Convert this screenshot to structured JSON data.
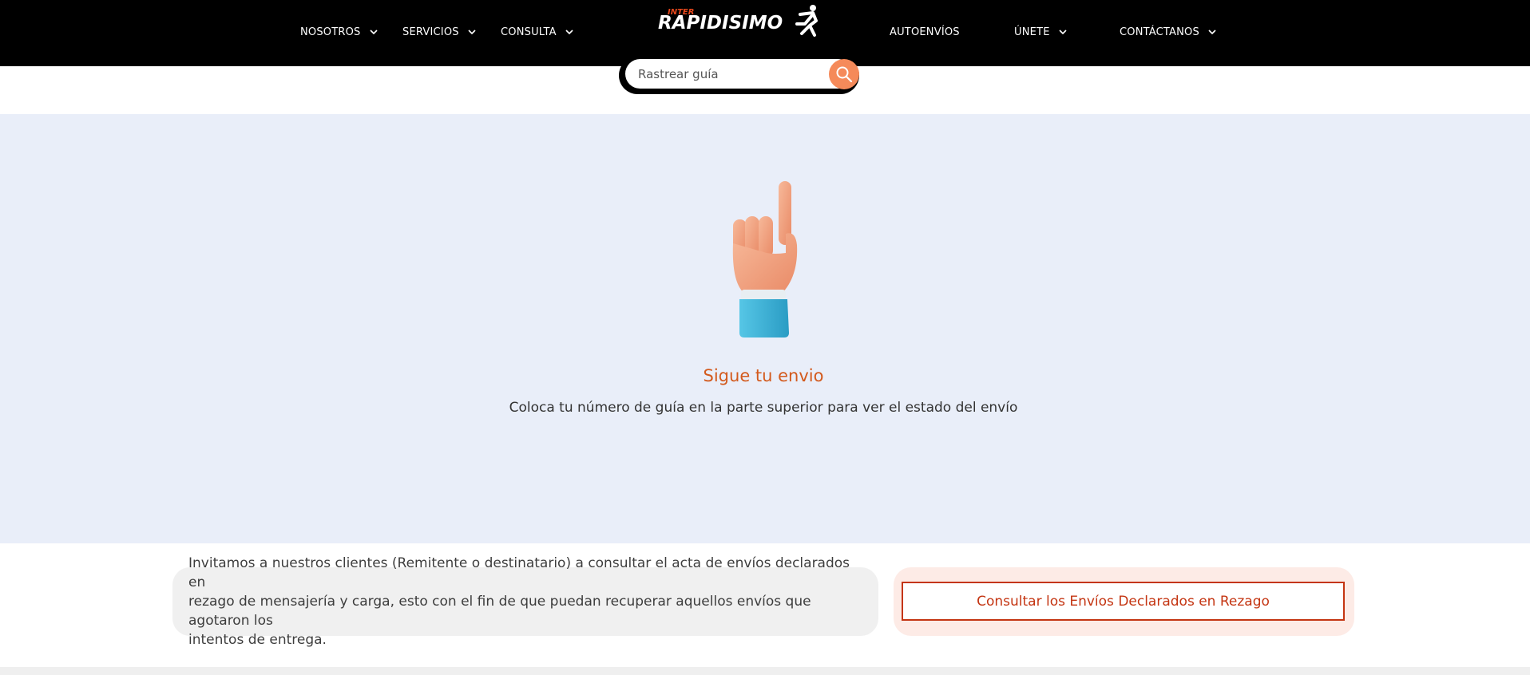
{
  "header": {
    "logo_alt": "INTER RAPIDISIMO",
    "logo_small": "INTER",
    "logo_main": "RAPIDISIMO",
    "nav_left": [
      {
        "label": "NOSOTROS",
        "has_dropdown": true
      },
      {
        "label": "SERVICIOS",
        "has_dropdown": true
      },
      {
        "label": "CONSULTA",
        "has_dropdown": true
      }
    ],
    "nav_right": [
      {
        "label": "AUTOENVÍOS",
        "has_dropdown": false
      },
      {
        "label": "ÚNETE",
        "has_dropdown": true
      },
      {
        "label": "CONTÁCTANOS",
        "has_dropdown": true
      }
    ]
  },
  "search": {
    "placeholder": "Rastrear guía",
    "value": ""
  },
  "main": {
    "icon": "pointing-up-hand-icon",
    "title": "Sigue tu envio",
    "subtitle": "Coloca tu número de guía en la parte superior para ver el estado del envío"
  },
  "notice": {
    "lines": [
      "Invitamos a nuestros clientes (Remitente o destinatario) a consultar el acta de envíos declarados en",
      "rezago de mensajería y carga, esto con el fin de que puedan recuperar aquellos envíos que agotaron los",
      "intentos de entrega."
    ]
  },
  "cta": {
    "label": "Consultar los Envíos Declarados en Rezago"
  },
  "colors": {
    "header_bg": "#000000",
    "accent_orange": "#d35a1d",
    "search_button": "#f58a5a",
    "main_bg": "#e9eef9",
    "cta_border": "#c43512"
  }
}
